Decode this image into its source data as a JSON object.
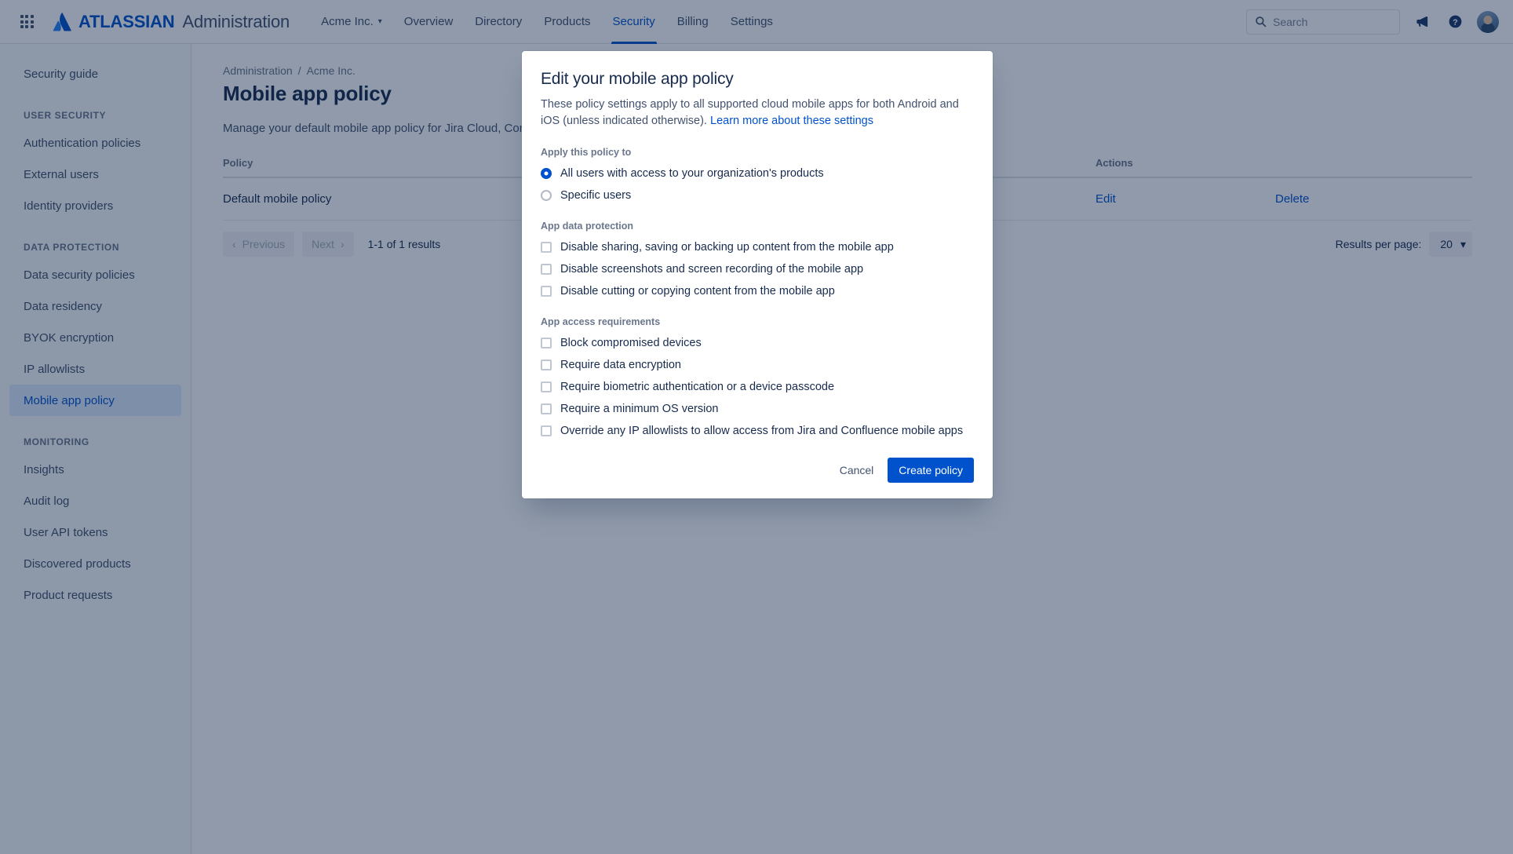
{
  "colors": {
    "accent": "#0052CC",
    "text": "#172B4D",
    "subtle_text": "#6B778C",
    "selected_nav_bg": "#DEEBFF",
    "border": "#DFE1E6",
    "overlay": "rgba(9,30,66,0.45)"
  },
  "topnav": {
    "app_switcher_icon": "grid-apps-icon",
    "brand_logo_icon": "atlassian-logo-icon",
    "brand_name": "ATLASSIAN",
    "brand_product": "Administration",
    "org_switcher": {
      "label": "Acme Inc.",
      "caret_icon": "chevron-down-icon"
    },
    "links": [
      {
        "label": "Overview",
        "active": false
      },
      {
        "label": "Directory",
        "active": false
      },
      {
        "label": "Products",
        "active": false
      },
      {
        "label": "Security",
        "active": true
      },
      {
        "label": "Billing",
        "active": false
      },
      {
        "label": "Settings",
        "active": false
      }
    ],
    "search": {
      "placeholder": "Search",
      "value": "",
      "icon": "search-icon"
    },
    "notifications_icon": "megaphone-icon",
    "help_icon": "help-circle-icon",
    "avatar_icon": "user-avatar"
  },
  "sidebar": {
    "top_items": [
      {
        "label": "Security guide",
        "selected": false
      }
    ],
    "sections": [
      {
        "heading": "USER SECURITY",
        "items": [
          {
            "label": "Authentication policies",
            "selected": false
          },
          {
            "label": "External users",
            "selected": false
          },
          {
            "label": "Identity providers",
            "selected": false
          }
        ]
      },
      {
        "heading": "DATA PROTECTION",
        "items": [
          {
            "label": "Data security policies",
            "selected": false
          },
          {
            "label": "Data residency",
            "selected": false
          },
          {
            "label": "BYOK encryption",
            "selected": false
          },
          {
            "label": "IP allowlists",
            "selected": false
          },
          {
            "label": "Mobile app policy",
            "selected": true
          }
        ]
      },
      {
        "heading": "MONITORING",
        "items": [
          {
            "label": "Insights",
            "selected": false
          },
          {
            "label": "Audit log",
            "selected": false
          },
          {
            "label": "User API tokens",
            "selected": false
          },
          {
            "label": "Discovered products",
            "selected": false
          },
          {
            "label": "Product requests",
            "selected": false
          }
        ]
      }
    ]
  },
  "main": {
    "breadcrumb": [
      "Administration",
      "Acme Inc."
    ],
    "breadcrumb_separator": "/",
    "page_title": "Mobile app policy",
    "page_description": "Manage your default mobile app policy for Jira Cloud, Confluence Cloud and Opsgenie",
    "table": {
      "columns": [
        "Policy",
        "Actions"
      ],
      "rows": [
        {
          "policy": "Default mobile policy",
          "actions": [
            "Edit",
            "Delete"
          ]
        }
      ]
    },
    "pagination": {
      "previous_label": "Previous",
      "previous_icon": "chevron-left-icon",
      "next_label": "Next",
      "next_icon": "chevron-right-icon",
      "results_summary": "1-1 of 1 results",
      "results_per_page_label": "Results per page:",
      "results_per_page_value": "20",
      "results_per_page_caret": "chevron-down-icon"
    }
  },
  "modal": {
    "title": "Edit your mobile app policy",
    "description": "These policy settings apply to all supported cloud mobile apps for both Android and iOS (unless indicated otherwise).",
    "description_link": "Learn more about these settings",
    "apply_group": {
      "label": "Apply this policy to",
      "options": [
        {
          "label": "All users with access to your organization's products",
          "checked": true
        },
        {
          "label": "Specific users",
          "checked": false
        }
      ]
    },
    "data_protection_group": {
      "label": "App data protection",
      "options": [
        {
          "label": "Disable sharing, saving or backing up content from the mobile app",
          "checked": false
        },
        {
          "label": "Disable screenshots and screen recording of the mobile app",
          "checked": false
        },
        {
          "label": "Disable cutting or copying content from the mobile app",
          "checked": false
        }
      ]
    },
    "access_group": {
      "label": "App access requirements",
      "options": [
        {
          "label": "Block compromised devices",
          "checked": false
        },
        {
          "label": "Require data encryption",
          "checked": false
        },
        {
          "label": "Require biometric authentication or a device passcode",
          "checked": false
        },
        {
          "label": "Require a minimum OS version",
          "checked": false
        },
        {
          "label": "Override any IP allowlists to allow access from Jira and Confluence mobile apps",
          "checked": false
        }
      ]
    },
    "cancel_label": "Cancel",
    "submit_label": "Create policy"
  }
}
